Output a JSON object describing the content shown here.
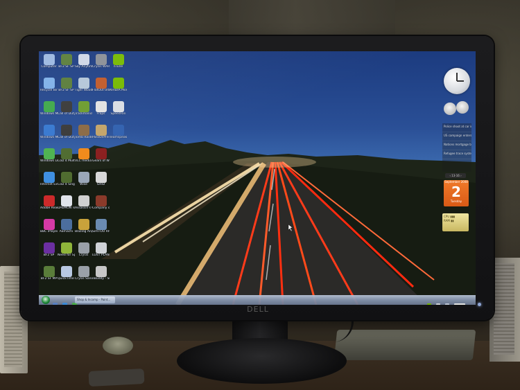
{
  "screen": {
    "desktop_icons": [
      {
        "label": "Computer",
        "icon": "computer-icon",
        "color": "#9bb7e0"
      },
      {
        "label": "BF2 SF SP",
        "icon": "game-icon",
        "color": "#5a7d3a"
      },
      {
        "label": "Sky Anytime",
        "icon": "sky-icon",
        "color": "#cfd6e6"
      },
      {
        "label": "Crysis WARHEAD",
        "icon": "game-icon",
        "color": "#8a8f96"
      },
      {
        "label": "nTune",
        "icon": "nvidia-icon",
        "color": "#76b900"
      },
      {
        "label": "Recycle Bin",
        "icon": "recycle-bin-icon",
        "color": "#7fb0e8"
      },
      {
        "label": "BF2 SF SP",
        "icon": "game-icon",
        "color": "#5a7d3a"
      },
      {
        "label": "Tiger Woods PGA TOUR 07",
        "icon": "game-icon",
        "color": "#b4c6d8"
      },
      {
        "label": "FlatOut Ultima...",
        "icon": "game-icon",
        "color": "#c05a2a"
      },
      {
        "label": "NVIDIA Monitor",
        "icon": "nvidia-icon",
        "color": "#76b900"
      },
      {
        "label": "Windows Media Center",
        "icon": "media-center-icon",
        "color": "#3fa84a"
      },
      {
        "label": "Call of Duty(R) 2...",
        "icon": "game-icon",
        "color": "#3a3a3a"
      },
      {
        "label": "Trackmania...",
        "icon": "game-icon",
        "color": "#6d9c2f"
      },
      {
        "label": "Fraps",
        "icon": "fraps-icon",
        "color": "#e2e2e2"
      },
      {
        "label": "SpeedFan",
        "icon": "fan-icon",
        "color": "#d9dde3"
      },
      {
        "label": "Windows Media Player",
        "icon": "media-player-icon",
        "color": "#3778d0"
      },
      {
        "label": "Call of Duty(R) 2...",
        "icon": "game-icon",
        "color": "#3a3a3a"
      },
      {
        "label": "Tomb Raider - Anniversary",
        "icon": "game-icon",
        "color": "#8b6a45"
      },
      {
        "label": "PassOnPress - Shortcut",
        "icon": "shortcut-icon",
        "color": "#c3a56a"
      },
      {
        "label": "Teamspeak 2 RC2",
        "icon": "teamspeak-icon",
        "color": "#3262b0"
      },
      {
        "label": "Windows Live Mess...",
        "icon": "messenger-icon",
        "color": "#4db34f"
      },
      {
        "label": "CoD 4 Multiplayer",
        "icon": "game-icon",
        "color": "#4f6b2f"
      },
      {
        "label": "VLC media player",
        "icon": "vlc-icon",
        "color": "#f08a1a"
      },
      {
        "label": "Gears of War for Windows",
        "icon": "game-icon",
        "color": "#8a1f1f"
      },
      {
        "label": "Internet Explorer",
        "icon": "internet-explorer-icon",
        "color": "#3e8fe0"
      },
      {
        "label": "CoD 4 Singleplayer",
        "icon": "game-icon",
        "color": "#4f6b2f"
      },
      {
        "label": "Wise",
        "icon": "app-icon",
        "color": "#9aa6b8"
      },
      {
        "label": "GRID",
        "icon": "game-icon",
        "color": "#d8d8d8"
      },
      {
        "label": "Adobe Reader 9",
        "icon": "adobe-reader-icon",
        "color": "#cc2a2a"
      },
      {
        "label": "DAEMON Tools Lite",
        "icon": "daemon-tools-icon",
        "color": "#e0e4ea"
      },
      {
        "label": "Assassin's Creed",
        "icon": "game-icon",
        "color": "#d0d0d0"
      },
      {
        "label": "Company of Heroes",
        "icon": "game-icon",
        "color": "#8a3a2a"
      },
      {
        "label": "BBC iPlayer Downloa...",
        "icon": "iplayer-icon",
        "color": "#d63aa5"
      },
      {
        "label": "Aamachi",
        "icon": "app-icon",
        "color": "#4c6e9e"
      },
      {
        "label": "Blazing Angels 2",
        "icon": "game-icon",
        "color": "#c9a23b"
      },
      {
        "label": "SimTOO RPGS",
        "icon": "game-icon",
        "color": "#6a8bb2"
      },
      {
        "label": "BF2 SP",
        "icon": "game-icon",
        "color": "#6b2fa0"
      },
      {
        "label": "Need for Speed...",
        "icon": "game-icon",
        "color": "#8fb53a"
      },
      {
        "label": "Crysis",
        "icon": "game-icon",
        "color": "#9aa0a8"
      },
      {
        "label": "LOST PLANET...",
        "icon": "game-icon",
        "color": "#cfd2d6"
      },
      {
        "label": "BF2 SF MP",
        "icon": "game-icon",
        "color": "#5a7d3a"
      },
      {
        "label": "QuickTime Player",
        "icon": "quicktime-icon",
        "color": "#b8c8e2"
      },
      {
        "label": "Crysis Sandb...",
        "icon": "game-icon",
        "color": "#9aa0a8"
      },
      {
        "label": "eBuddy - Shortcut",
        "icon": "shortcut-icon",
        "color": "#c7c7c7"
      }
    ],
    "sidebar": {
      "feed_items": [
        "Police shoot at car in...",
        "US campaign enters...",
        "Nations mortgage bailout...",
        "Refugee trace system..."
      ],
      "feed_nav": "‹ 13-16 ›",
      "calendar": {
        "month": "September 2008",
        "day": "2",
        "weekday": "Tuesday"
      }
    },
    "taskbar": {
      "task_label": "Shop & Incomp - Paint..."
    }
  },
  "colors": {
    "taskbar": "#8594ad",
    "calendar": "#e06a20",
    "light_trail_red": "#ff3b1a",
    "light_trail_white": "#ffe6b0"
  }
}
